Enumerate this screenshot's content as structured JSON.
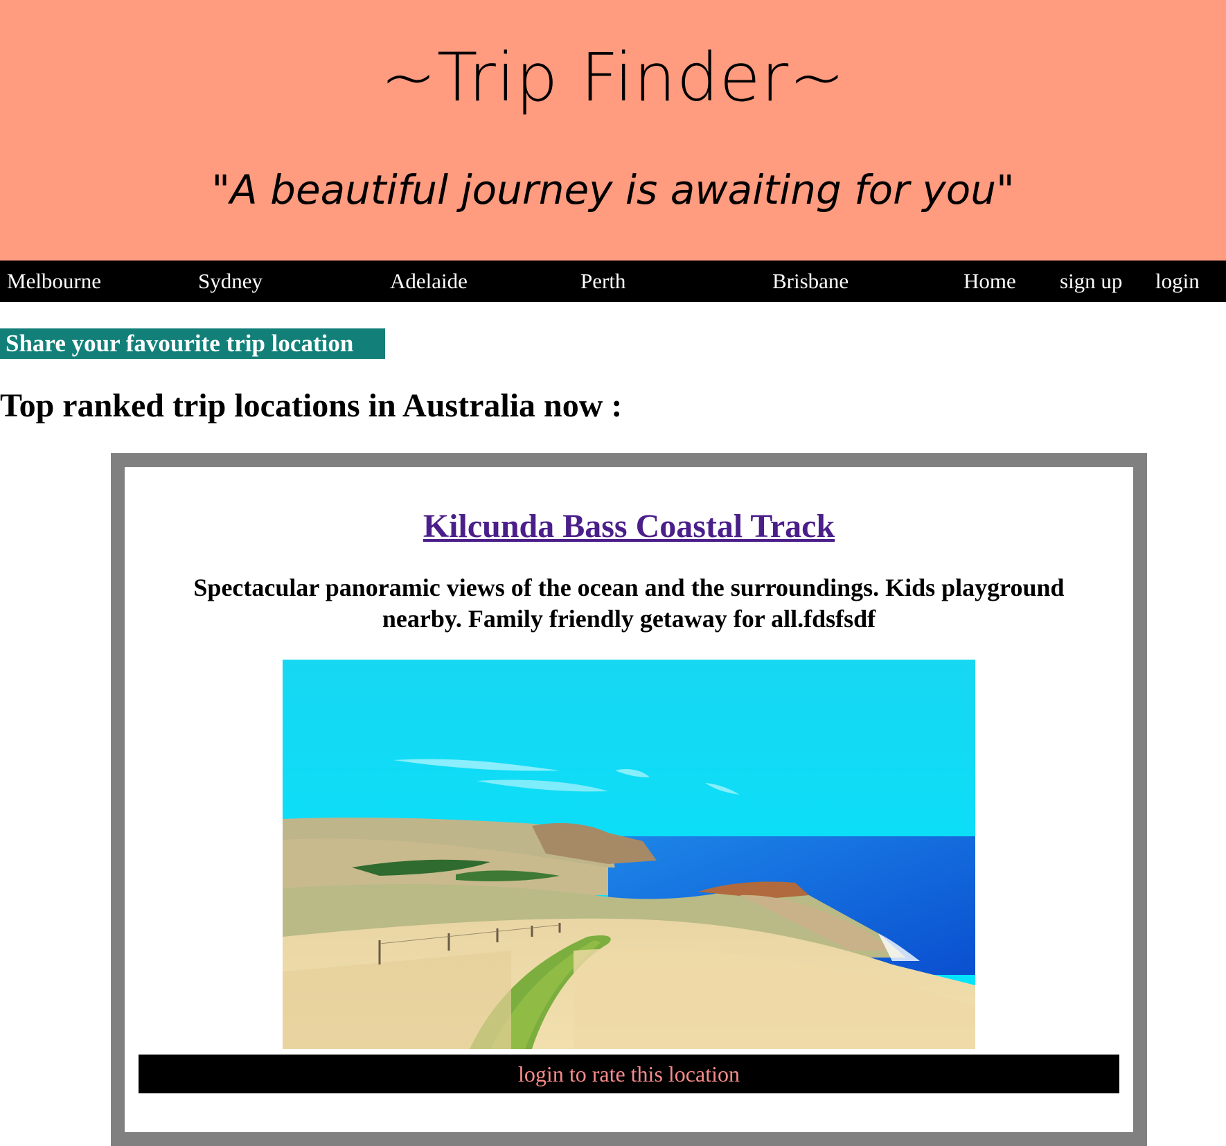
{
  "header": {
    "title": "~Trip Finder~",
    "tagline": "\"A beautiful journey is awaiting for you\""
  },
  "nav": {
    "cities": [
      "Melbourne",
      "Sydney",
      "Adelaide",
      "Perth",
      "Brisbane"
    ],
    "home": "Home",
    "sign_up": "sign up",
    "login": "login"
  },
  "share_button": "Share your favourite trip location",
  "section_heading": "Top ranked trip locations in Australia now :",
  "card": {
    "title": "Kilcunda Bass Coastal Track",
    "description": "Spectacular panoramic views of the ocean and the surroundings. Kids playground nearby. Family friendly getaway for all.fdsfsdf",
    "rate_prompt": "login to rate this location"
  },
  "colors": {
    "header_bg": "#ff9b7f",
    "nav_bg": "#000000",
    "share_bg": "#128079",
    "card_border": "#808080",
    "title_link": "#4b1f8a",
    "rate_text": "#f98b8b"
  }
}
